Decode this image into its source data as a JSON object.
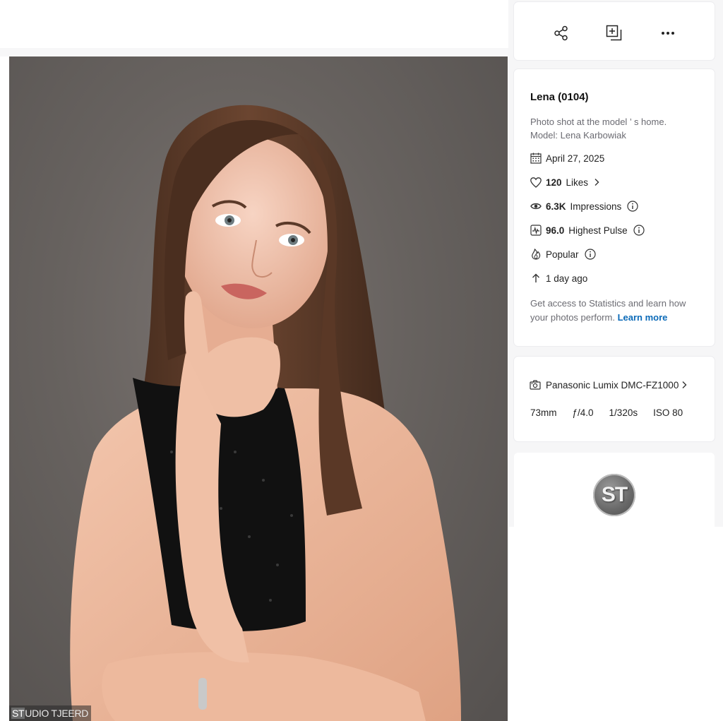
{
  "photo": {
    "watermark_prefix": "ST",
    "watermark_rest": "UDIO TJEERD"
  },
  "actions": {
    "share_icon": "share-icon",
    "add_to_gallery_icon": "add-to-gallery-icon",
    "more_icon": "more-icon"
  },
  "info": {
    "title": "Lena (0104)",
    "description_line1": "Photo shot at the model ’ s home.",
    "description_line2": "Model: Lena Karbowiak",
    "date": "April 27, 2025",
    "likes_count": "120",
    "likes_label": "Likes",
    "impressions_count": "6.3K",
    "impressions_label": "Impressions",
    "pulse_value": "96.0",
    "pulse_label": "Highest Pulse",
    "popular_label": "Popular",
    "uploaded": "1 day ago",
    "stats_note": "Get access to Statistics and learn how your photos perform.",
    "learn_more": "Learn more"
  },
  "camera": {
    "model": "Panasonic Lumix DMC-FZ1000",
    "focal_length": "73mm",
    "aperture": "ƒ/4.0",
    "shutter": "1/320s",
    "iso": "ISO 80"
  },
  "profile": {
    "avatar_text": "ST"
  },
  "colors": {
    "link": "#0b6ab8",
    "sidebar_bg": "#f6f6f7",
    "muted_text": "#6b6b72"
  }
}
